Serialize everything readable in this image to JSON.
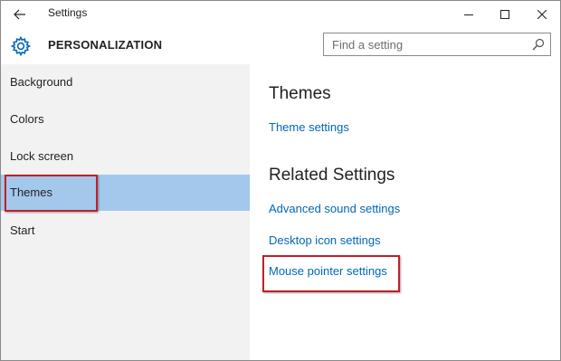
{
  "window": {
    "title": "Settings",
    "back_icon": "arrow-left-icon",
    "controls": [
      "minimize-icon",
      "maximize-icon",
      "close-icon"
    ]
  },
  "header": {
    "icon": "gear-icon",
    "section_title": "PERSONALIZATION",
    "search": {
      "placeholder": "Find a setting",
      "value": "",
      "icon": "search-icon"
    }
  },
  "sidebar": {
    "items": [
      {
        "label": "Background",
        "selected": false
      },
      {
        "label": "Colors",
        "selected": false
      },
      {
        "label": "Lock screen",
        "selected": false
      },
      {
        "label": "Themes",
        "selected": true
      },
      {
        "label": "Start",
        "selected": false
      }
    ]
  },
  "main": {
    "themes_heading": "Themes",
    "theme_settings_link": "Theme settings",
    "related_heading": "Related Settings",
    "related_links": [
      "Advanced sound settings",
      "Desktop icon settings",
      "Mouse pointer settings"
    ]
  },
  "colors": {
    "accent": "#0067b8",
    "selected_bg": "#a3c8ec",
    "sidebar_bg": "#f2f2f2",
    "annotation": "#c0202a"
  }
}
